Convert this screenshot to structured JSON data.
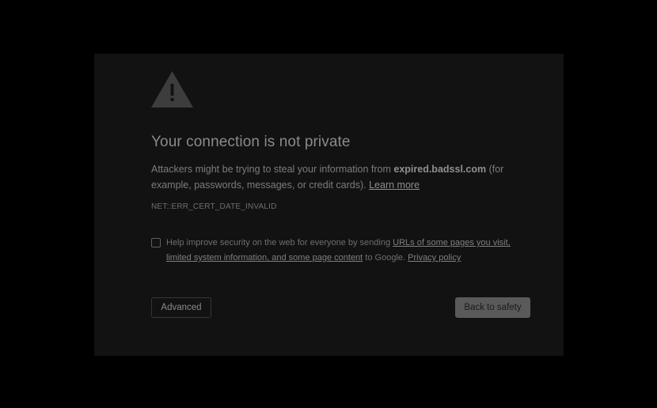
{
  "interstitial": {
    "icon": "warning-triangle-icon",
    "title": "Your connection is not private",
    "description": {
      "before": "Attackers might be trying to steal your information from ",
      "host": "expired.badssl.com",
      "after": " (for example, passwords, messages, or credit cards). ",
      "learn_more": "Learn more"
    },
    "error_code": "NET::ERR_CERT_DATE_INVALID",
    "reporting": {
      "checked": false,
      "before": "Help improve security on the web for everyone by sending ",
      "link_urls": "URLs of some pages you visit, limited system information, and some page content",
      "middle": " to Google. ",
      "privacy_policy": "Privacy policy"
    },
    "buttons": {
      "advanced": "Advanced",
      "back_to_safety": "Back to safety"
    }
  },
  "colors": {
    "page_background": "#000000",
    "panel_background": "#121212",
    "icon_fill": "#3d3d3d",
    "primary_button": "#5a5a5a"
  }
}
